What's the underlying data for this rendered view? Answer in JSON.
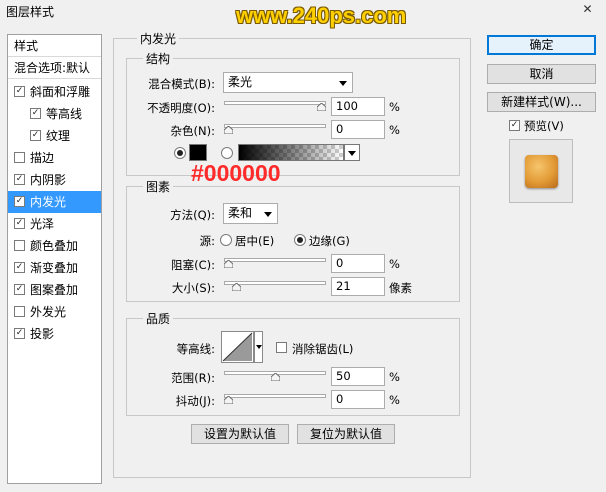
{
  "window": {
    "title": "图层样式",
    "watermark": "www.240ps.com",
    "close_icon": "✕"
  },
  "style_list": {
    "header": "样式",
    "blend_options": "混合选项:默认",
    "items": [
      {
        "label": "斜面和浮雕",
        "checked": true,
        "indent": false,
        "selected": false
      },
      {
        "label": "等高线",
        "checked": true,
        "indent": true,
        "selected": false
      },
      {
        "label": "纹理",
        "checked": true,
        "indent": true,
        "selected": false
      },
      {
        "label": "描边",
        "checked": false,
        "indent": false,
        "selected": false
      },
      {
        "label": "内阴影",
        "checked": true,
        "indent": false,
        "selected": false
      },
      {
        "label": "内发光",
        "checked": true,
        "indent": false,
        "selected": true
      },
      {
        "label": "光泽",
        "checked": true,
        "indent": false,
        "selected": false
      },
      {
        "label": "颜色叠加",
        "checked": false,
        "indent": false,
        "selected": false
      },
      {
        "label": "渐变叠加",
        "checked": true,
        "indent": false,
        "selected": false
      },
      {
        "label": "图案叠加",
        "checked": true,
        "indent": false,
        "selected": false
      },
      {
        "label": "外发光",
        "checked": false,
        "indent": false,
        "selected": false
      },
      {
        "label": "投影",
        "checked": true,
        "indent": false,
        "selected": false
      }
    ],
    "check_mark": "✓"
  },
  "inner_glow": {
    "section_title": "内发光",
    "structure": {
      "title": "结构",
      "blend_mode_label": "混合模式(B):",
      "blend_mode_value": "柔光",
      "opacity_label": "不透明度(O):",
      "opacity_value": "100",
      "opacity_level": 1.0,
      "noise_label": "杂色(N):",
      "noise_value": "0",
      "noise_level": 0.0,
      "percent": "%",
      "color_hex_annotation": "#000000",
      "swatch_color": "#000000"
    },
    "elements": {
      "title": "图素",
      "method_label": "方法(Q):",
      "method_value": "柔和",
      "source_label": "源:",
      "source_center": "居中(E)",
      "source_edge": "边缘(G)",
      "choke_label": "阻塞(C):",
      "choke_value": "0",
      "choke_level": 0.0,
      "size_label": "大小(S):",
      "size_value": "21",
      "size_level": 0.084,
      "size_unit": "像素",
      "percent": "%"
    },
    "quality": {
      "title": "品质",
      "contour_label": "等高线:",
      "anti_alias_label": "消除锯齿(L)",
      "anti_alias_checked": false,
      "range_label": "范围(R):",
      "range_value": "50",
      "range_level": 0.5,
      "jitter_label": "抖动(J):",
      "jitter_value": "0",
      "jitter_level": 0.0,
      "percent": "%"
    },
    "make_default": "设置为默认值",
    "reset_default": "复位为默认值"
  },
  "right_panel": {
    "ok": "确定",
    "cancel": "取消",
    "new_style": "新建样式(W)...",
    "preview_label": "预览(V)",
    "preview_checked": true
  }
}
